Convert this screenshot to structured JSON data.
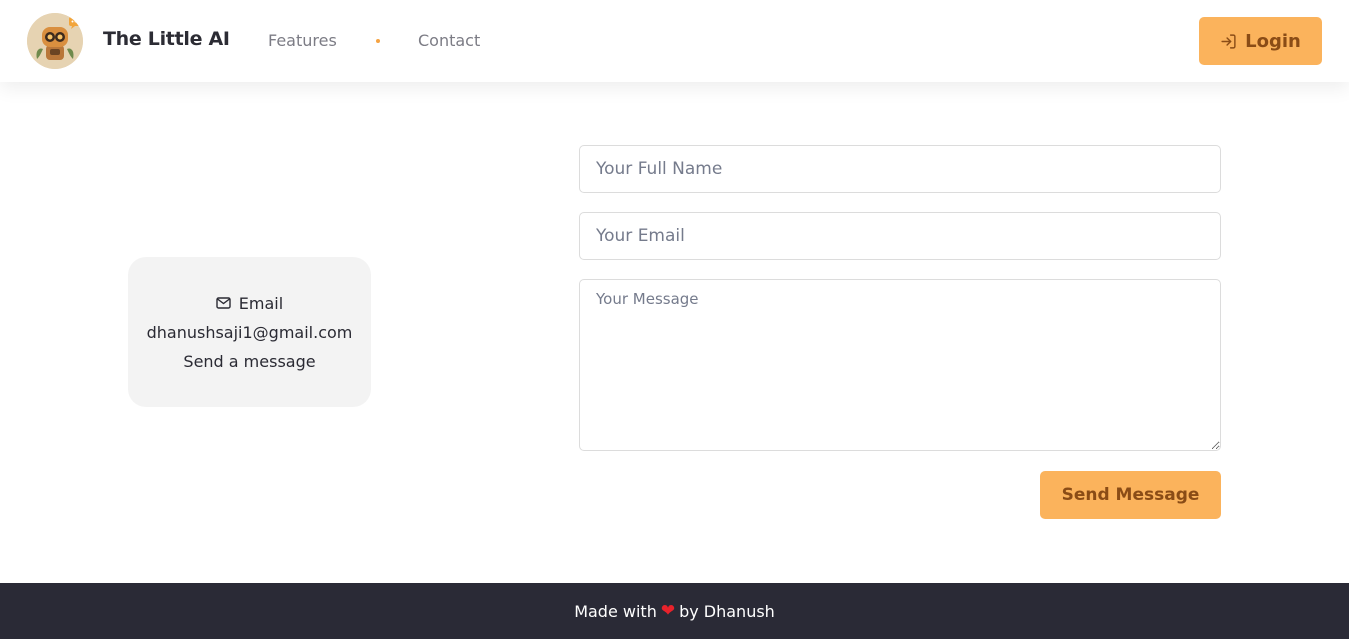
{
  "header": {
    "brand": "The Little AI",
    "nav": {
      "features": "Features",
      "contact": "Contact"
    },
    "login_label": "Login"
  },
  "contact_card": {
    "email_label": "Email",
    "email_address": "dhanushsaji1@gmail.com",
    "cta": "Send a message"
  },
  "form": {
    "name_placeholder": "Your Full Name",
    "email_placeholder": "Your Email",
    "message_placeholder": "Your Message",
    "submit_label": "Send Message"
  },
  "footer": {
    "made_with": "Made with",
    "by": "by Dhanush"
  },
  "colors": {
    "accent": "#fbb35c",
    "accent_text": "#8a4c16",
    "footer_bg": "#2a2a36",
    "heart": "#e8222b"
  },
  "icons": {
    "logo": "robot-avatar",
    "login": "login-icon",
    "email": "mail-icon",
    "heart": "heart-icon"
  }
}
